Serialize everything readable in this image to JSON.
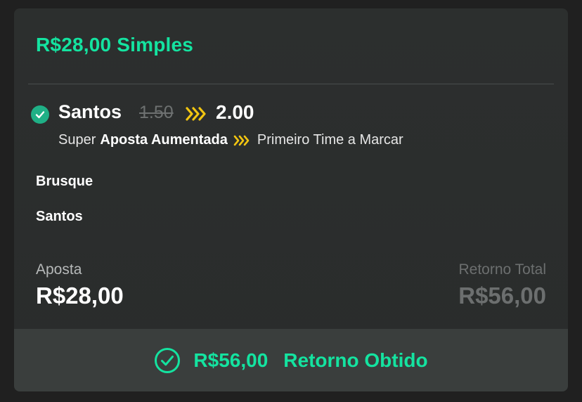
{
  "bet": {
    "header_title": "R$28,00 Simples",
    "selection": {
      "name": "Santos",
      "old_odds": "1.50",
      "new_odds": "2.00",
      "market_prefix": "Super",
      "market_bold": "Aposta Aumentada",
      "market_name": "Primeiro Time a Marcar"
    },
    "teams": [
      "Brusque",
      "Santos"
    ],
    "stake": {
      "label": "Aposta",
      "value": "R$28,00"
    },
    "total_return": {
      "label": "Retorno Total",
      "value": "R$56,00"
    },
    "footer": {
      "amount": "R$56,00",
      "status": "Retorno Obtido"
    }
  },
  "colors": {
    "accent": "#14e3a0",
    "check_badge": "#1fb086",
    "boost": "#f2c511",
    "card_bg": "#2c2f2e",
    "footer_bg": "#3a3e3d"
  },
  "icons": {
    "check": "check-circle-filled-icon",
    "boost": "double-chevron-boost-icon",
    "footer": "check-circle-outline-icon"
  }
}
